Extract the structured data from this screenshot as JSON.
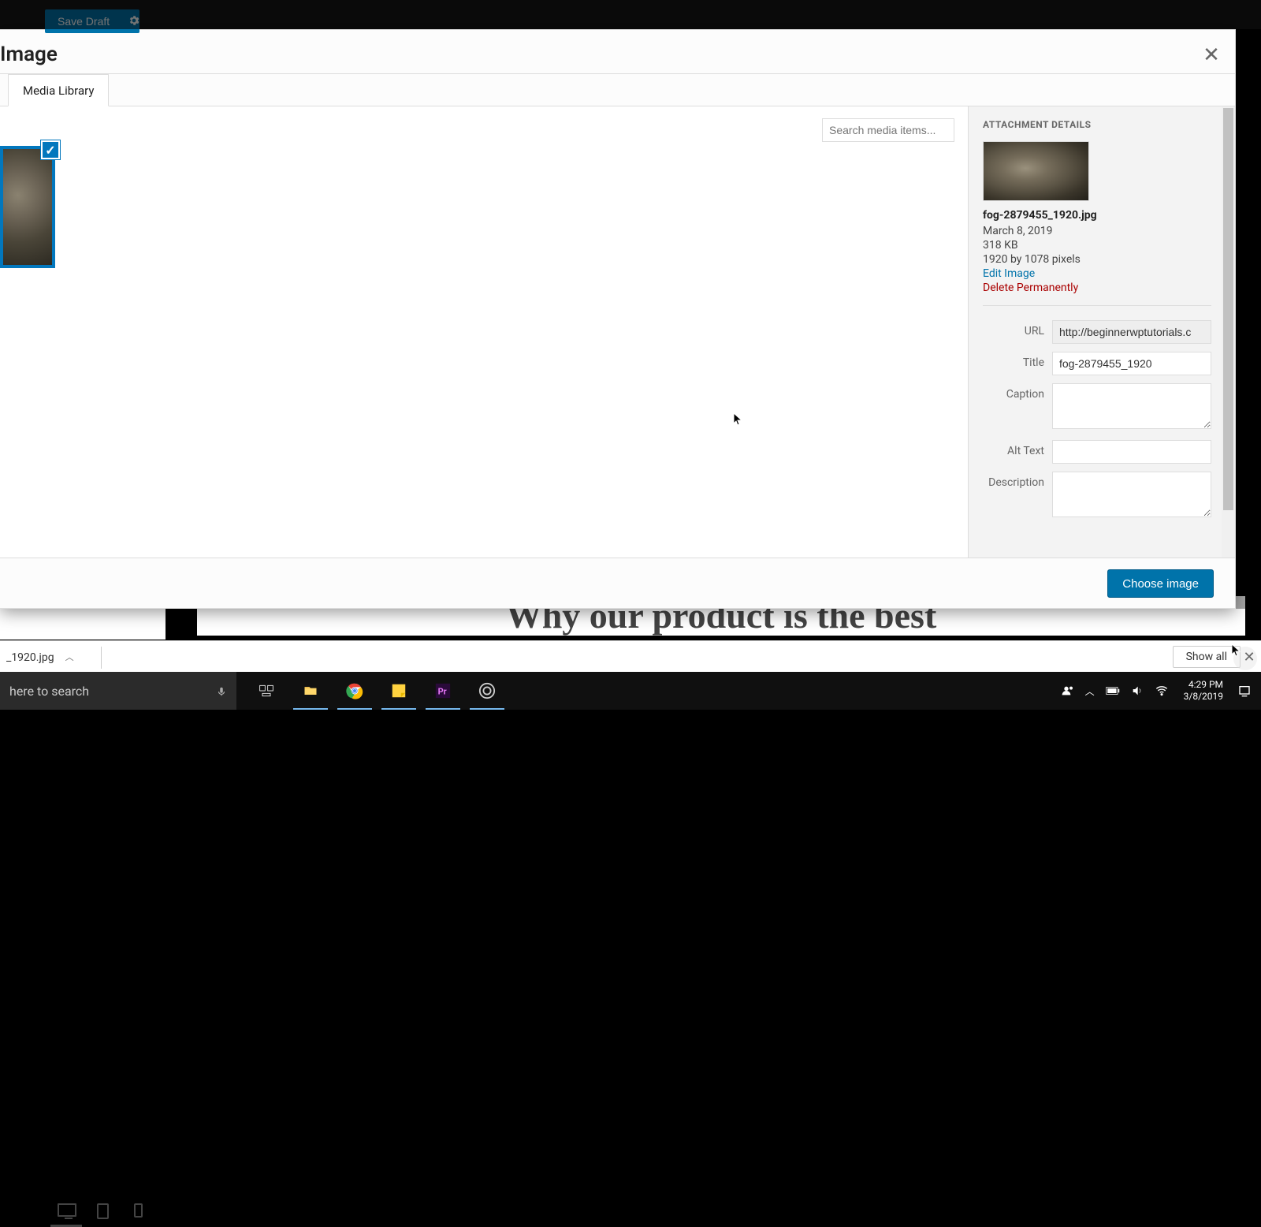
{
  "background": {
    "save_draft": "Save Draft",
    "heading": "Why our product is the best"
  },
  "modal": {
    "title": "Image",
    "close_glyph": "✕",
    "tabs": {
      "media_library": "Media Library"
    },
    "search_placeholder": "Search media items...",
    "choose_button": "Choose image"
  },
  "details": {
    "heading": "ATTACHMENT DETAILS",
    "filename": "fog-2879455_1920.jpg",
    "date": "March 8, 2019",
    "size": "318 KB",
    "dimensions": "1920 by 1078 pixels",
    "edit": "Edit Image",
    "delete": "Delete Permanently",
    "labels": {
      "url": "URL",
      "title": "Title",
      "caption": "Caption",
      "alt": "Alt Text",
      "description": "Description"
    },
    "values": {
      "url": "http://beginnerwptutorials.c",
      "title": "fog-2879455_1920",
      "caption": "",
      "alt": "",
      "description": ""
    }
  },
  "downloads": {
    "item": "_1920.jpg",
    "show_all": "Show all",
    "close_glyph": "✕"
  },
  "taskbar": {
    "search_placeholder": "here to search",
    "time": "4:29 PM",
    "date": "3/8/2019"
  }
}
